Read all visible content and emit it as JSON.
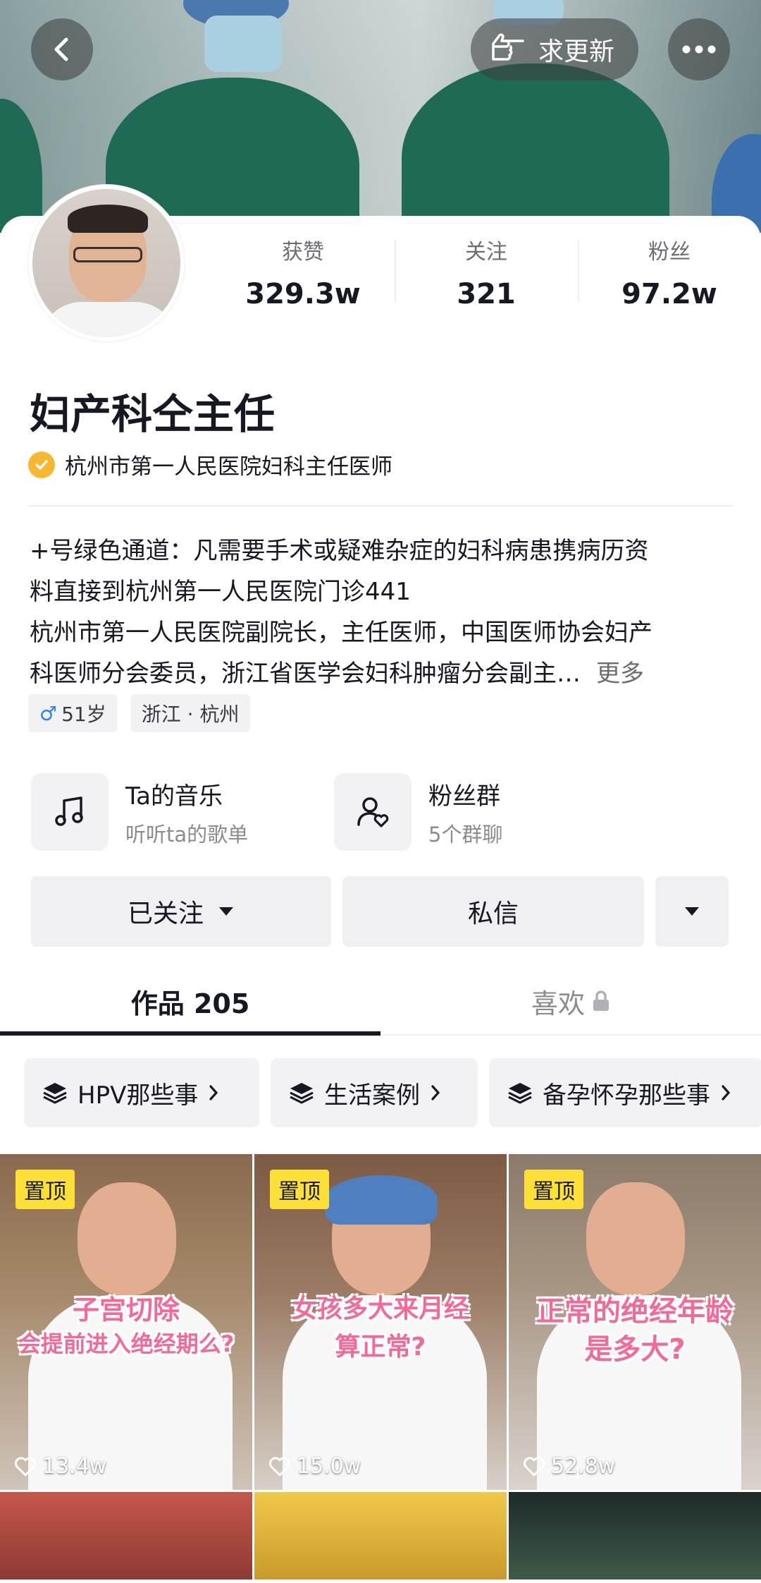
{
  "header": {
    "back_icon": "chevron-left-icon",
    "update_label": "求更新",
    "update_icon": "hand-point-icon",
    "more_icon": "ellipsis-icon"
  },
  "profile": {
    "stats": [
      {
        "label": "获赞",
        "value": "329.3w"
      },
      {
        "label": "关注",
        "value": "321"
      },
      {
        "label": "粉丝",
        "value": "97.2w"
      }
    ],
    "name": "妇产科仝主任",
    "verification": "杭州市第一人民医院妇科主任医师",
    "bio_lines": [
      "+号绿色通道：凡需要手术或疑难杂症的妇科病患携病历资",
      "料直接到杭州第一人民医院门诊441",
      "杭州市第一人民医院副院长，主任医师，中国医师协会妇产",
      "科医师分会委员，浙江省医学会妇科肿瘤分会副主…"
    ],
    "bio_more": "更多",
    "tags": {
      "gender_symbol": "♂",
      "age": "51岁",
      "location": "浙江 · 杭州"
    }
  },
  "entries": [
    {
      "title": "Ta的音乐",
      "subtitle": "听听ta的歌单",
      "icon": "music-note-icon"
    },
    {
      "title": "粉丝群",
      "subtitle": "5个群聊",
      "icon": "fan-group-icon"
    }
  ],
  "actions": {
    "followed": "已关注",
    "message": "私信"
  },
  "tabs": {
    "works": "作品 205",
    "likes": "喜欢"
  },
  "collections": [
    "HPV那些事",
    "生活案例",
    "备孕怀孕那些事"
  ],
  "videos": [
    {
      "badge": "置顶",
      "caption1": "子宫切除",
      "caption2": "会提前进入绝经期么?",
      "likes": "13.4w"
    },
    {
      "badge": "置顶",
      "caption1": "女孩多大来月经",
      "caption2": "算正常?",
      "likes": "15.0w"
    },
    {
      "badge": "置顶",
      "caption1": "正常的绝经年龄",
      "caption2": "是多大?",
      "likes": "52.8w"
    }
  ],
  "colors": {
    "accent_badge": "#fce037",
    "caption_pink": "#f26a98",
    "verified": "#f6b831",
    "male_blue": "#2f83f5"
  }
}
